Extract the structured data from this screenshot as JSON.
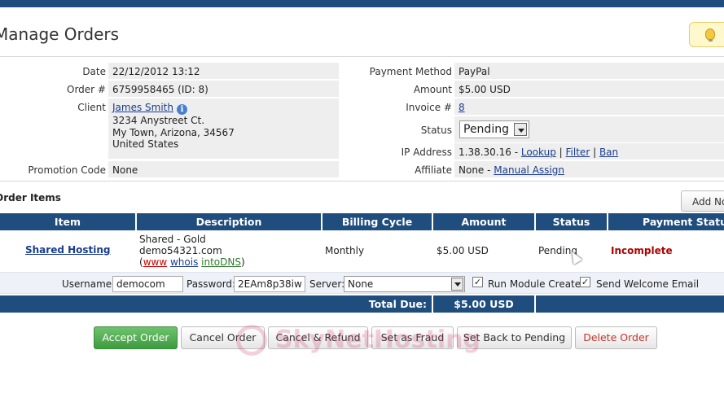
{
  "page": {
    "title": "Manage Orders"
  },
  "order": {
    "date_label": "Date",
    "date": "22/12/2012 13:12",
    "ordernum_label": "Order #",
    "ordernum": "6759958465 (ID: 8)",
    "client_label": "Client",
    "client_name": "James Smith",
    "client_addr1": "3234 Anystreet Ct.",
    "client_addr2": "My Town, Arizona, 34567",
    "client_addr3": "United States",
    "promo_label": "Promotion Code",
    "promo": "None",
    "paymethod_label": "Payment Method",
    "paymethod": "PayPal",
    "amount_label": "Amount",
    "amount": "$5.00 USD",
    "invoice_label": "Invoice #",
    "invoice": "8",
    "status_label": "Status",
    "status": "Pending",
    "ip_label": "IP Address",
    "ip": "1.38.30.16 -",
    "ip_lookup": "Lookup",
    "ip_sep": "|",
    "ip_filter": "Filter",
    "ip_ban": "Ban",
    "affiliate_label": "Affiliate",
    "affiliate": "None -",
    "affiliate_link": "Manual Assign"
  },
  "items": {
    "section_title": "Order Items",
    "add_label": "Add Note",
    "headers": [
      "Item",
      "Description",
      "Billing Cycle",
      "Amount",
      "Status",
      "Payment Status"
    ],
    "row": {
      "item": "Shared Hosting",
      "desc1": "Shared - Gold",
      "desc2": "demo54321.com",
      "paren_open": "(",
      "www": "www",
      "whois": "whois",
      "dns": "intoDNS",
      "paren_close": ")",
      "cycle": "Monthly",
      "amount": "$5.00 USD",
      "status": "Pending",
      "payment_status": "Incomplete"
    },
    "sub": {
      "username_label": "Username:",
      "username": "democom",
      "password_label": "Password:",
      "password": "2EAm8p38iw",
      "server_label": "Server:",
      "server": "None",
      "run_module": "Run Module Create",
      "send_welcome": "Send Welcome Email"
    },
    "total_label": "Total Due:",
    "total": "$5.00 USD"
  },
  "actions": {
    "accept": "Accept Order",
    "cancel": "Cancel Order",
    "refund": "Cancel & Refund",
    "fraud": "Set as Fraud",
    "pending": "Set Back to Pending",
    "delete": "Delete Order"
  },
  "watermark": "SkyNetHosting"
}
